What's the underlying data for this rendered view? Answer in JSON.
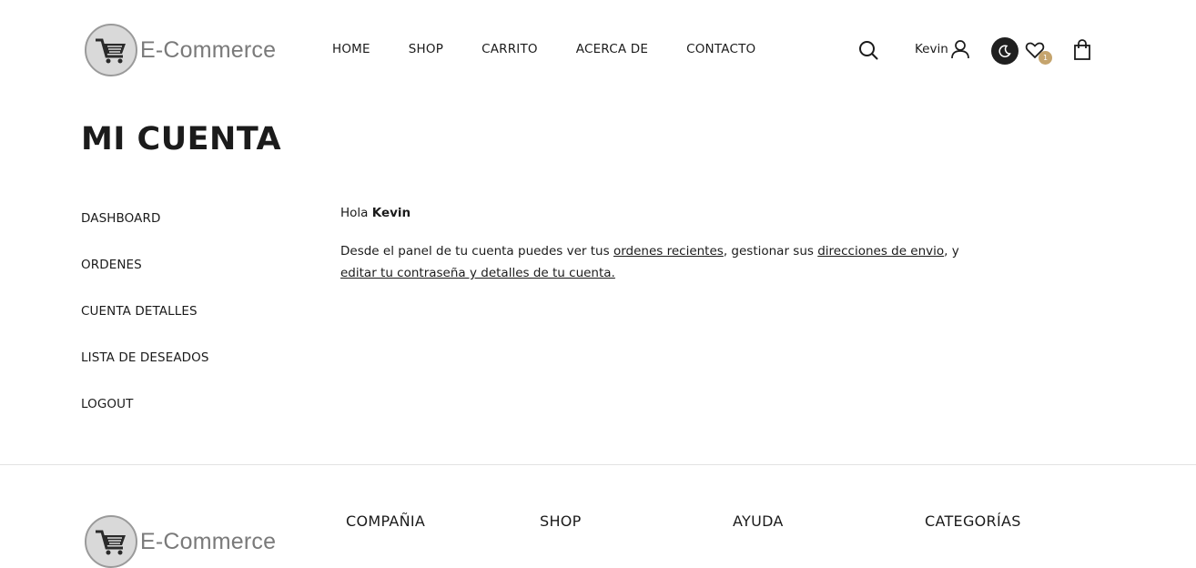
{
  "header": {
    "brand": "E-Commerce",
    "nav": [
      "HOME",
      "SHOP",
      "CARRITO",
      "ACERCA DE",
      "CONTACTO"
    ],
    "user_name": "Kevin",
    "wishlist_count": "1",
    "icons": [
      "search-icon",
      "user-icon",
      "moon-icon",
      "heart-icon",
      "shopping-bag-icon"
    ]
  },
  "page": {
    "title": "MI CUENTA"
  },
  "sidebar": {
    "items": [
      {
        "label": "DASHBOARD"
      },
      {
        "label": "ORDENES"
      },
      {
        "label": "CUENTA DETALLES"
      },
      {
        "label": "LISTA DE DESEADOS"
      },
      {
        "label": "LOGOUT"
      }
    ]
  },
  "dashboard": {
    "greeting": "Hola",
    "name": "Kevin",
    "desc_1": "Desde el panel de tu cuenta puedes ver tus",
    "link_orders": "ordenes recientes",
    "desc_2": ", gestionar sus",
    "link_addresses": "direcciones de envio",
    "desc_3": ", y",
    "link_edit": "editar tu contraseña y detalles de tu cuenta."
  },
  "footer": {
    "brand": "E-Commerce",
    "columns": [
      "COMPAÑIA",
      "SHOP",
      "AYUDA",
      "CATEGORÍAS"
    ]
  }
}
